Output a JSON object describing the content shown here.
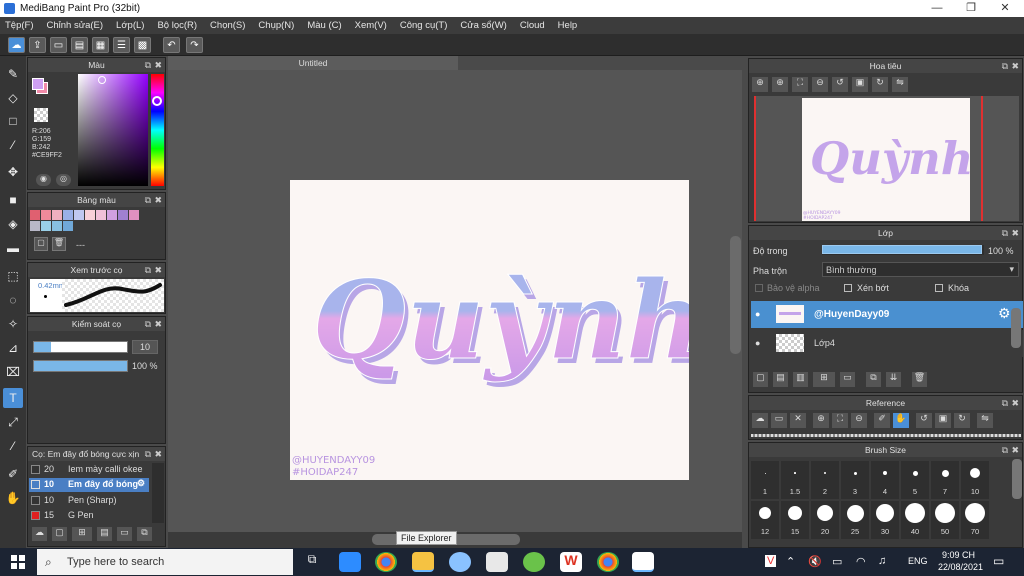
{
  "window": {
    "title": "MediBang Paint Pro (32bit)",
    "minimize": "—",
    "maximize": "❐",
    "close": "✕"
  },
  "menu": [
    "Tệp(F)",
    "Chỉnh sửa(E)",
    "Lớp(L)",
    "Bộ lọc(R)",
    "Chọn(S)",
    "Chụp(N)",
    "Màu (C)",
    "Xem(V)",
    "Công cụ(T)",
    "Cửa sổ(W)",
    "Cloud",
    "Help"
  ],
  "toolbar": {
    "undo": "↶",
    "redo": "↷"
  },
  "color_panel": {
    "title": "Màu",
    "r": "R:206",
    "g": "G:159",
    "b": "B:242",
    "hex": "#CE9FF2",
    "fg": "#ce9ff2",
    "bg": "#f08aa8"
  },
  "palette_panel": {
    "title": "Bảng màu",
    "placeholder": "---",
    "swatches": [
      "#e06070",
      "#f08a9a",
      "#f0b0c0",
      "#9ab0e8",
      "#c0c8f0",
      "#f8d0d8",
      "#f0c0d8",
      "#d0a0e0",
      "#a080d0",
      "#e090c0",
      "#b8b8c8",
      "#9ad0e8",
      "#88c0e0",
      "#70a8d8"
    ]
  },
  "brush_preview": {
    "title": "Xem trước cọ",
    "size": "0.42mm"
  },
  "brush_control": {
    "title": "Kiểm soát cọ",
    "size_value": "10",
    "opacity_value": "100 %",
    "size_fraction": 0.1,
    "opacity_fraction": 1.0
  },
  "brush_list": {
    "title": "Cọ: Em đây đổ bóng cực xịn",
    "items": [
      {
        "size": "20",
        "name": "Iem mày calli okee",
        "color": "#333333"
      },
      {
        "size": "10",
        "name": "Em đây đổ bóng",
        "color": "#4a7fc4"
      },
      {
        "size": "10",
        "name": "Pen (Sharp)",
        "color": "#333333"
      },
      {
        "size": "15",
        "name": "G Pen",
        "color": "#e02020"
      }
    ]
  },
  "document": {
    "tab": "Untitled"
  },
  "canvas_art": {
    "word": "Quỳnh",
    "watermark1": "@HUYENDAYY09",
    "watermark2": "#HOIDAP247"
  },
  "navigator": {
    "title": "Hoa tiêu"
  },
  "layer_panel": {
    "title": "Lớp",
    "opacity_label": "Độ trong",
    "opacity_value": "100 %",
    "opacity_fraction": 1.0,
    "blend_label": "Pha trộn",
    "blend_value": "Bình thường",
    "protect_alpha": "Bảo vệ alpha",
    "clipping": "Xén bớt",
    "lock": "Khóa",
    "layers": [
      {
        "name": "@HuyenDayy09",
        "selected": true
      },
      {
        "name": "Lớp4",
        "selected": false
      }
    ]
  },
  "reference_panel": {
    "title": "Reference"
  },
  "brush_size_panel": {
    "title": "Brush Size",
    "sizes": [
      "1",
      "1.5",
      "2",
      "3",
      "4",
      "5",
      "7",
      "10",
      "12",
      "15",
      "20",
      "25",
      "30",
      "40",
      "50",
      "70"
    ]
  },
  "tooltip": "File Explorer",
  "taskbar": {
    "search_placeholder": "Type here to search",
    "lang": "ENG",
    "time": "9:09 CH",
    "date": "22/08/2021"
  }
}
